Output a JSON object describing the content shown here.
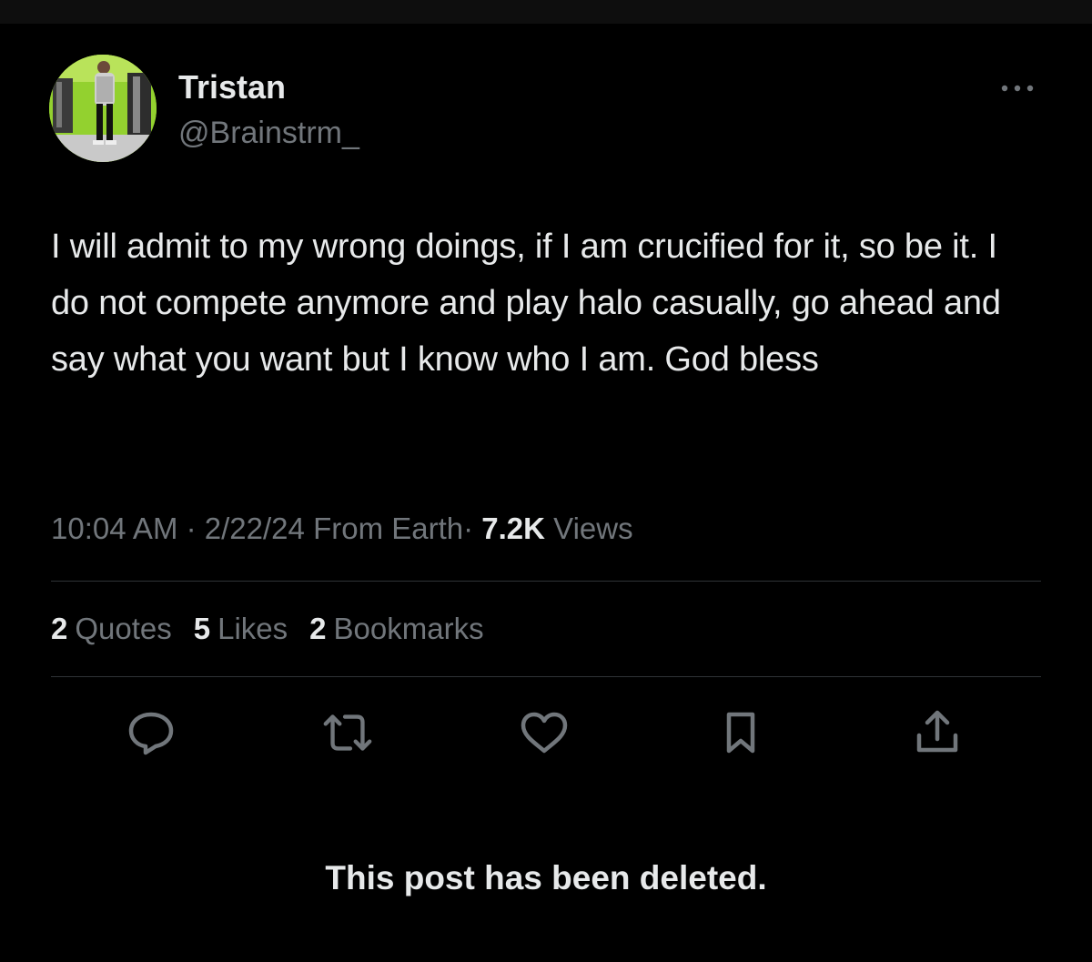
{
  "author": {
    "display_name": "Tristan",
    "handle": "@Brainstrm_"
  },
  "post": {
    "text": "I will admit to my wrong doings, if I am crucified for it, so be it. I do not compete anymore and play halo casually, go ahead and say what you want but I know who I am. God bless",
    "time": "10:04 AM",
    "date": "2/22/24",
    "source": "From Earth",
    "separator": "·",
    "views_count": "7.2K",
    "views_label": "Views"
  },
  "stats": [
    {
      "count": "2",
      "label": "Quotes"
    },
    {
      "count": "5",
      "label": "Likes"
    },
    {
      "count": "2",
      "label": "Bookmarks"
    }
  ],
  "actions": [
    {
      "name": "reply",
      "icon": "reply-icon"
    },
    {
      "name": "repost",
      "icon": "repost-icon"
    },
    {
      "name": "like",
      "icon": "heart-icon"
    },
    {
      "name": "bookmark",
      "icon": "bookmark-icon"
    },
    {
      "name": "share",
      "icon": "share-icon"
    }
  ],
  "notice": "This post has been deleted.",
  "colors": {
    "background": "#000000",
    "text_primary": "#e7e9ea",
    "text_secondary": "#71767b",
    "divider": "#2f3336",
    "avatar_bg": "#8fcf2c"
  }
}
